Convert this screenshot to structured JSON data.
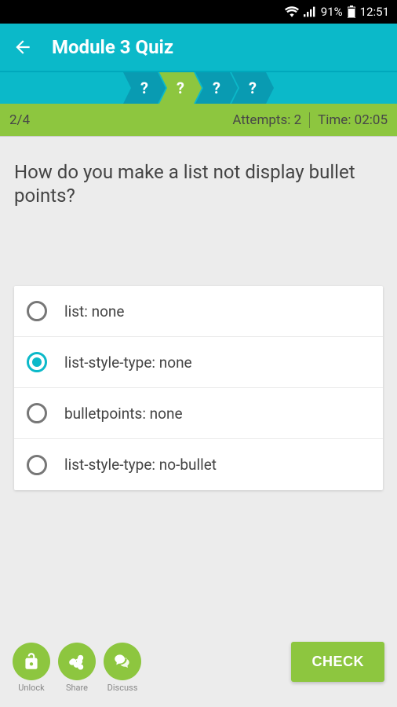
{
  "status": {
    "battery_pct": "91%",
    "time": "12:51"
  },
  "header": {
    "title": "Module 3 Quiz"
  },
  "progress_steps": [
    "?",
    "?",
    "?",
    "?"
  ],
  "info": {
    "counter": "2/4",
    "attempts_label": "Attempts: 2",
    "time_label": "Time: 02:05"
  },
  "question": "How do you make a list not display bullet points?",
  "options": [
    {
      "label": "list: none",
      "selected": false
    },
    {
      "label": "list-style-type: none",
      "selected": true
    },
    {
      "label": "bulletpoints: none",
      "selected": false
    },
    {
      "label": "list-style-type: no-bullet",
      "selected": false
    }
  ],
  "actions": {
    "unlock": "Unlock",
    "share": "Share",
    "discuss": "Discuss",
    "check": "CHECK"
  }
}
